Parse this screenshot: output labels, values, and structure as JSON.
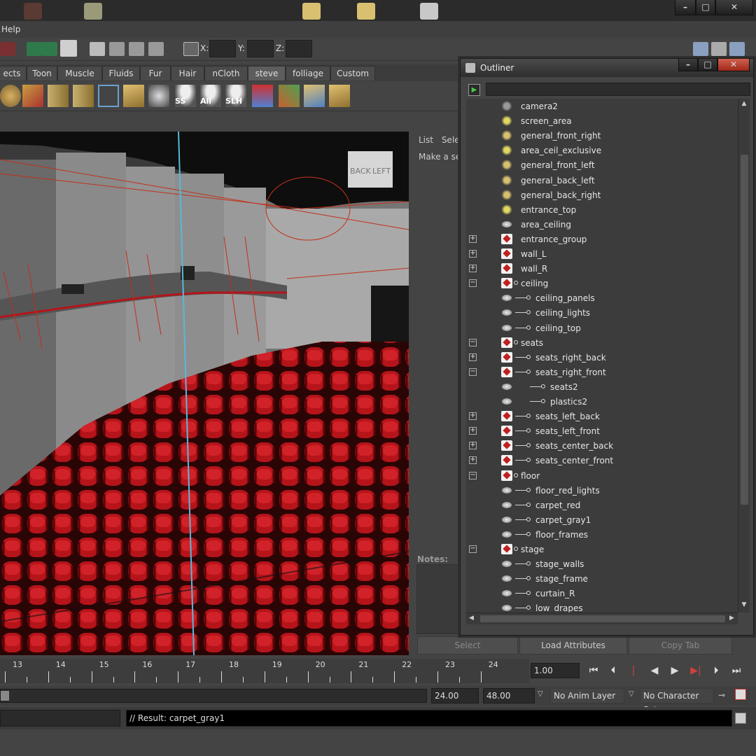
{
  "menu": {
    "help_label": "Help"
  },
  "status_line": {
    "x_label": "X:",
    "y_label": "Y:",
    "z_label": "Z:"
  },
  "shelf_tabs": [
    "ects",
    "Toon",
    "Muscle",
    "Fluids",
    "Fur",
    "Hair",
    "nCloth",
    "steve",
    "folliage",
    "Custom"
  ],
  "active_shelf_tab": "steve",
  "shelf_labels": {
    "ss": "SS",
    "all": "All",
    "slh": "SLH"
  },
  "viewcube": {
    "back": "BACK",
    "left": "LEFT"
  },
  "right_panel": {
    "tab_list": "List",
    "tab_select": "Sele",
    "hint": "Make a sele",
    "notes_label": "Notes:",
    "btn_select": "Select",
    "btn_load": "Load Attributes",
    "btn_copy": "Copy Tab"
  },
  "outliner": {
    "title": "Outliner",
    "items": [
      {
        "label": "camera2",
        "icon": "camera",
        "depth": 0
      },
      {
        "label": "screen_area",
        "icon": "area-light",
        "depth": 0
      },
      {
        "label": "general_front_right",
        "icon": "spot-light",
        "depth": 0
      },
      {
        "label": "area_ceil_exclusive",
        "icon": "area-light",
        "depth": 0
      },
      {
        "label": "general_front_left",
        "icon": "spot-light",
        "depth": 0
      },
      {
        "label": "general_back_left",
        "icon": "spot-light",
        "depth": 0
      },
      {
        "label": "general_back_right",
        "icon": "spot-light",
        "depth": 0
      },
      {
        "label": "entrance_top",
        "icon": "area-light",
        "depth": 0
      },
      {
        "label": "area_ceiling",
        "icon": "mesh",
        "depth": 0
      },
      {
        "label": "entrance_group",
        "icon": "group",
        "depth": 0,
        "expander": "+"
      },
      {
        "label": "wall_L",
        "icon": "group",
        "depth": 0,
        "expander": "+"
      },
      {
        "label": "wall_R",
        "icon": "group",
        "depth": 0,
        "expander": "+"
      },
      {
        "label": "ceiling",
        "icon": "group",
        "depth": 0,
        "expander": "−"
      },
      {
        "label": "ceiling_panels",
        "icon": "mesh",
        "depth": 1
      },
      {
        "label": "ceiling_lights",
        "icon": "mesh",
        "depth": 1
      },
      {
        "label": "ceiling_top",
        "icon": "mesh",
        "depth": 1
      },
      {
        "label": "seats",
        "icon": "group",
        "depth": 0,
        "expander": "−"
      },
      {
        "label": "seats_right_back",
        "icon": "group",
        "depth": 1,
        "expander": "+"
      },
      {
        "label": "seats_right_front",
        "icon": "group",
        "depth": 1,
        "expander": "−"
      },
      {
        "label": "seats2",
        "icon": "mesh",
        "depth": 2
      },
      {
        "label": "plastics2",
        "icon": "mesh",
        "depth": 2
      },
      {
        "label": "seats_left_back",
        "icon": "group",
        "depth": 1,
        "expander": "+"
      },
      {
        "label": "seats_left_front",
        "icon": "group",
        "depth": 1,
        "expander": "+"
      },
      {
        "label": "seats_center_back",
        "icon": "group",
        "depth": 1,
        "expander": "+"
      },
      {
        "label": "seats_center_front",
        "icon": "group",
        "depth": 1,
        "expander": "+"
      },
      {
        "label": "floor",
        "icon": "group",
        "depth": 0,
        "expander": "−"
      },
      {
        "label": "floor_red_lights",
        "icon": "mesh",
        "depth": 1
      },
      {
        "label": "carpet_red",
        "icon": "mesh",
        "depth": 1
      },
      {
        "label": "carpet_gray1",
        "icon": "mesh",
        "depth": 1
      },
      {
        "label": "floor_frames",
        "icon": "mesh",
        "depth": 1
      },
      {
        "label": "stage",
        "icon": "group",
        "depth": 0,
        "expander": "−"
      },
      {
        "label": "stage_walls",
        "icon": "mesh",
        "depth": 1
      },
      {
        "label": "stage_frame",
        "icon": "mesh",
        "depth": 1
      },
      {
        "label": "curtain_R",
        "icon": "mesh",
        "depth": 1
      },
      {
        "label": "low_drapes",
        "icon": "mesh",
        "depth": 1
      }
    ]
  },
  "timeline": {
    "ticks": [
      "13",
      "14",
      "15",
      "16",
      "17",
      "18",
      "19",
      "20",
      "21",
      "22",
      "23",
      "24"
    ],
    "current_frame": "1.00"
  },
  "range": {
    "end_value": "24.00",
    "max_value": "48.00",
    "anim_layer": "No Anim Layer",
    "character_set": "No Character Set"
  },
  "command": {
    "result": "// Result: carpet_gray1"
  },
  "colors": {
    "accent_red": "#b5141a",
    "outliner_bg": "#3c3c3c"
  }
}
